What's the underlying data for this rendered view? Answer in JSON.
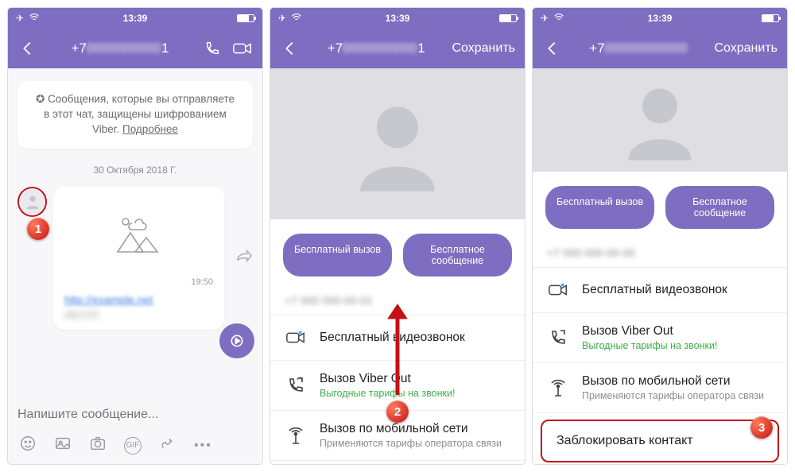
{
  "status": {
    "time": "13:39"
  },
  "colors": {
    "accent": "#7d6ec1",
    "badge": "#c61017",
    "green": "#3fae4a"
  },
  "screen1": {
    "header_title_prefix": "+7",
    "header_title_suffix": "1",
    "encryption_text": "Сообщения, которые вы отправляете в этот чат, защищены шифрованием Viber.",
    "encryption_link": "Подробнее",
    "date": "30 Октября 2018 Г.",
    "msg_time": "19:50",
    "msg_link": "http://",
    "input_placeholder": "Напишите сообщение...",
    "step": "1"
  },
  "screen2": {
    "header_title_prefix": "+7",
    "header_title_suffix": "1",
    "save": "Сохранить",
    "btn_call": "Бесплатный вызов",
    "btn_msg": "Бесплатное сообщение",
    "phone_prefix": "+7",
    "phone_suffix": "1",
    "item_video": "Бесплатный видеозвонок",
    "item_viberout": "Вызов Viber Out",
    "item_viberout_sub": "Выгодные тарифы на звонки!",
    "item_mobile": "Вызов по мобильной сети",
    "item_mobile_sub": "Применяются тарифы оператора связи",
    "step": "2"
  },
  "screen3": {
    "header_title_prefix": "+7",
    "save": "Сохранить",
    "btn_call": "Бесплатный вызов",
    "btn_msg": "Бесплатное сообщение",
    "phone_prefix": "+7",
    "item_video": "Бесплатный видеозвонок",
    "item_viberout": "Вызов Viber Out",
    "item_viberout_sub": "Выгодные тарифы на звонки!",
    "item_mobile": "Вызов по мобильной сети",
    "item_mobile_sub": "Применяются тарифы оператора связи",
    "item_block": "Заблокировать контакт",
    "step": "3"
  }
}
